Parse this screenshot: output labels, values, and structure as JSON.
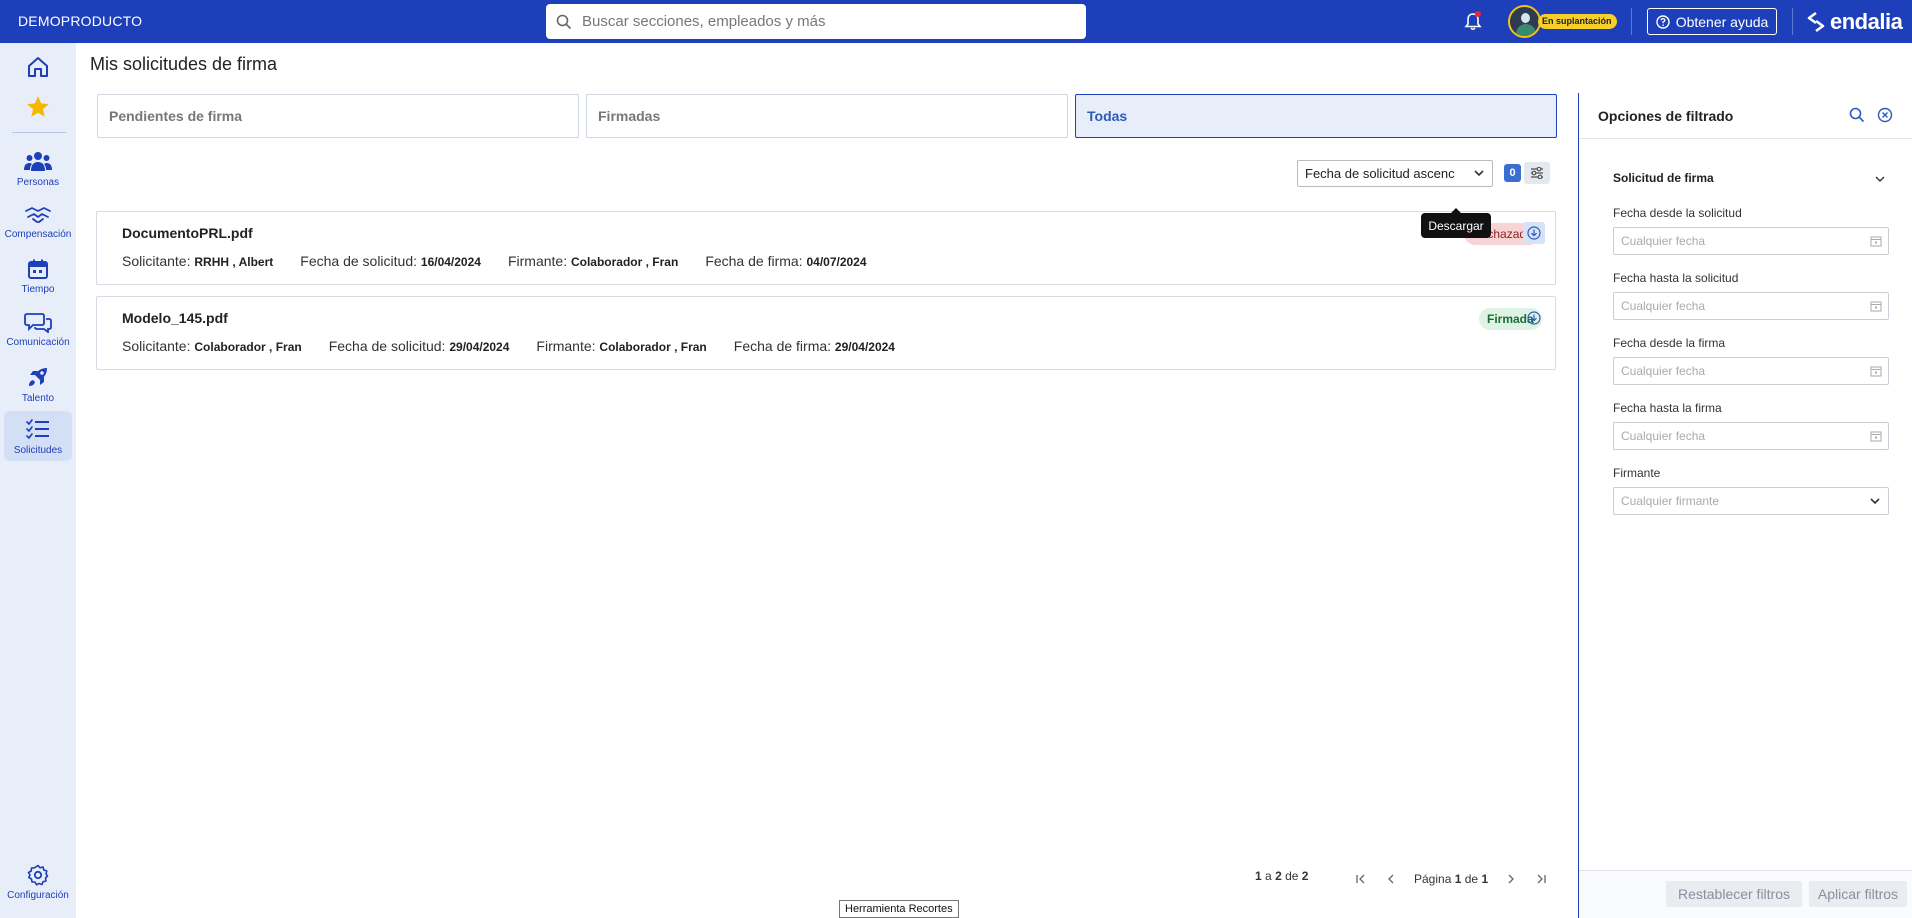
{
  "topbar": {
    "brand": "DEMOPRODUCTO",
    "search_placeholder": "Buscar secciones, empleados y más",
    "impersonation_badge": "En suplantación",
    "help_label": "Obtener ayuda",
    "logo_text": "endalia",
    "accent": "#1d3fba"
  },
  "sidebar": {
    "items": [
      {
        "label": "",
        "icon": "home-icon"
      },
      {
        "label": "",
        "icon": "star-icon"
      },
      {
        "label": "Personas",
        "icon": "people-icon"
      },
      {
        "label": "Compensación",
        "icon": "handshake-icon"
      },
      {
        "label": "Tiempo",
        "icon": "calendar-icon"
      },
      {
        "label": "Comunicación",
        "icon": "chat-icon"
      },
      {
        "label": "Talento",
        "icon": "rocket-icon"
      },
      {
        "label": "Solicitudes",
        "icon": "checklist-icon"
      },
      {
        "label": "Configuración",
        "icon": "gear-icon"
      }
    ],
    "active": "Solicitudes"
  },
  "main": {
    "title": "Mis solicitudes de firma",
    "tabs": [
      {
        "label": "Pendientes de firma",
        "active": false
      },
      {
        "label": "Firmadas",
        "active": false
      },
      {
        "label": "Todas",
        "active": true
      }
    ],
    "sort_value": "Fecha de solicitud ascenc",
    "filter_count": "0",
    "requests": [
      {
        "filename": "DocumentoPRL.pdf",
        "status": "Rechazada",
        "requester_label": "Solicitante:",
        "requester": "RRHH , Albert",
        "request_date_label": "Fecha de solicitud:",
        "request_date": "16/04/2024",
        "signer_label": "Firmante:",
        "signer": "Colaborador , Fran",
        "sign_date_label": "Fecha de firma:",
        "sign_date": "04/07/2024"
      },
      {
        "filename": "Modelo_145.pdf",
        "status": "Firmada",
        "requester_label": "Solicitante:",
        "requester": "Colaborador , Fran",
        "request_date_label": "Fecha de solicitud:",
        "request_date": "29/04/2024",
        "signer_label": "Firmante:",
        "signer": "Colaborador , Fran",
        "sign_date_label": "Fecha de firma:",
        "sign_date": "29/04/2024"
      }
    ],
    "tooltip": "Descargar",
    "pagination": {
      "from": "1",
      "to": "2",
      "total": "2",
      "a": "a",
      "de": "de",
      "page_label": "Página",
      "page": "1",
      "pages": "1"
    }
  },
  "filters": {
    "title": "Opciones de filtrado",
    "section": "Solicitud de firma",
    "fields": [
      {
        "label": "Fecha desde la solicitud",
        "placeholder": "Cualquier fecha"
      },
      {
        "label": "Fecha hasta la solicitud",
        "placeholder": "Cualquier fecha"
      },
      {
        "label": "Fecha desde la firma",
        "placeholder": "Cualquier fecha"
      },
      {
        "label": "Fecha hasta la firma",
        "placeholder": "Cualquier fecha"
      },
      {
        "label": "Firmante",
        "placeholder": "Cualquier firmante"
      }
    ],
    "reset_label": "Restablecer filtros",
    "apply_label": "Aplicar filtros"
  },
  "taskbar": {
    "snip_label": "Herramienta Recortes"
  }
}
